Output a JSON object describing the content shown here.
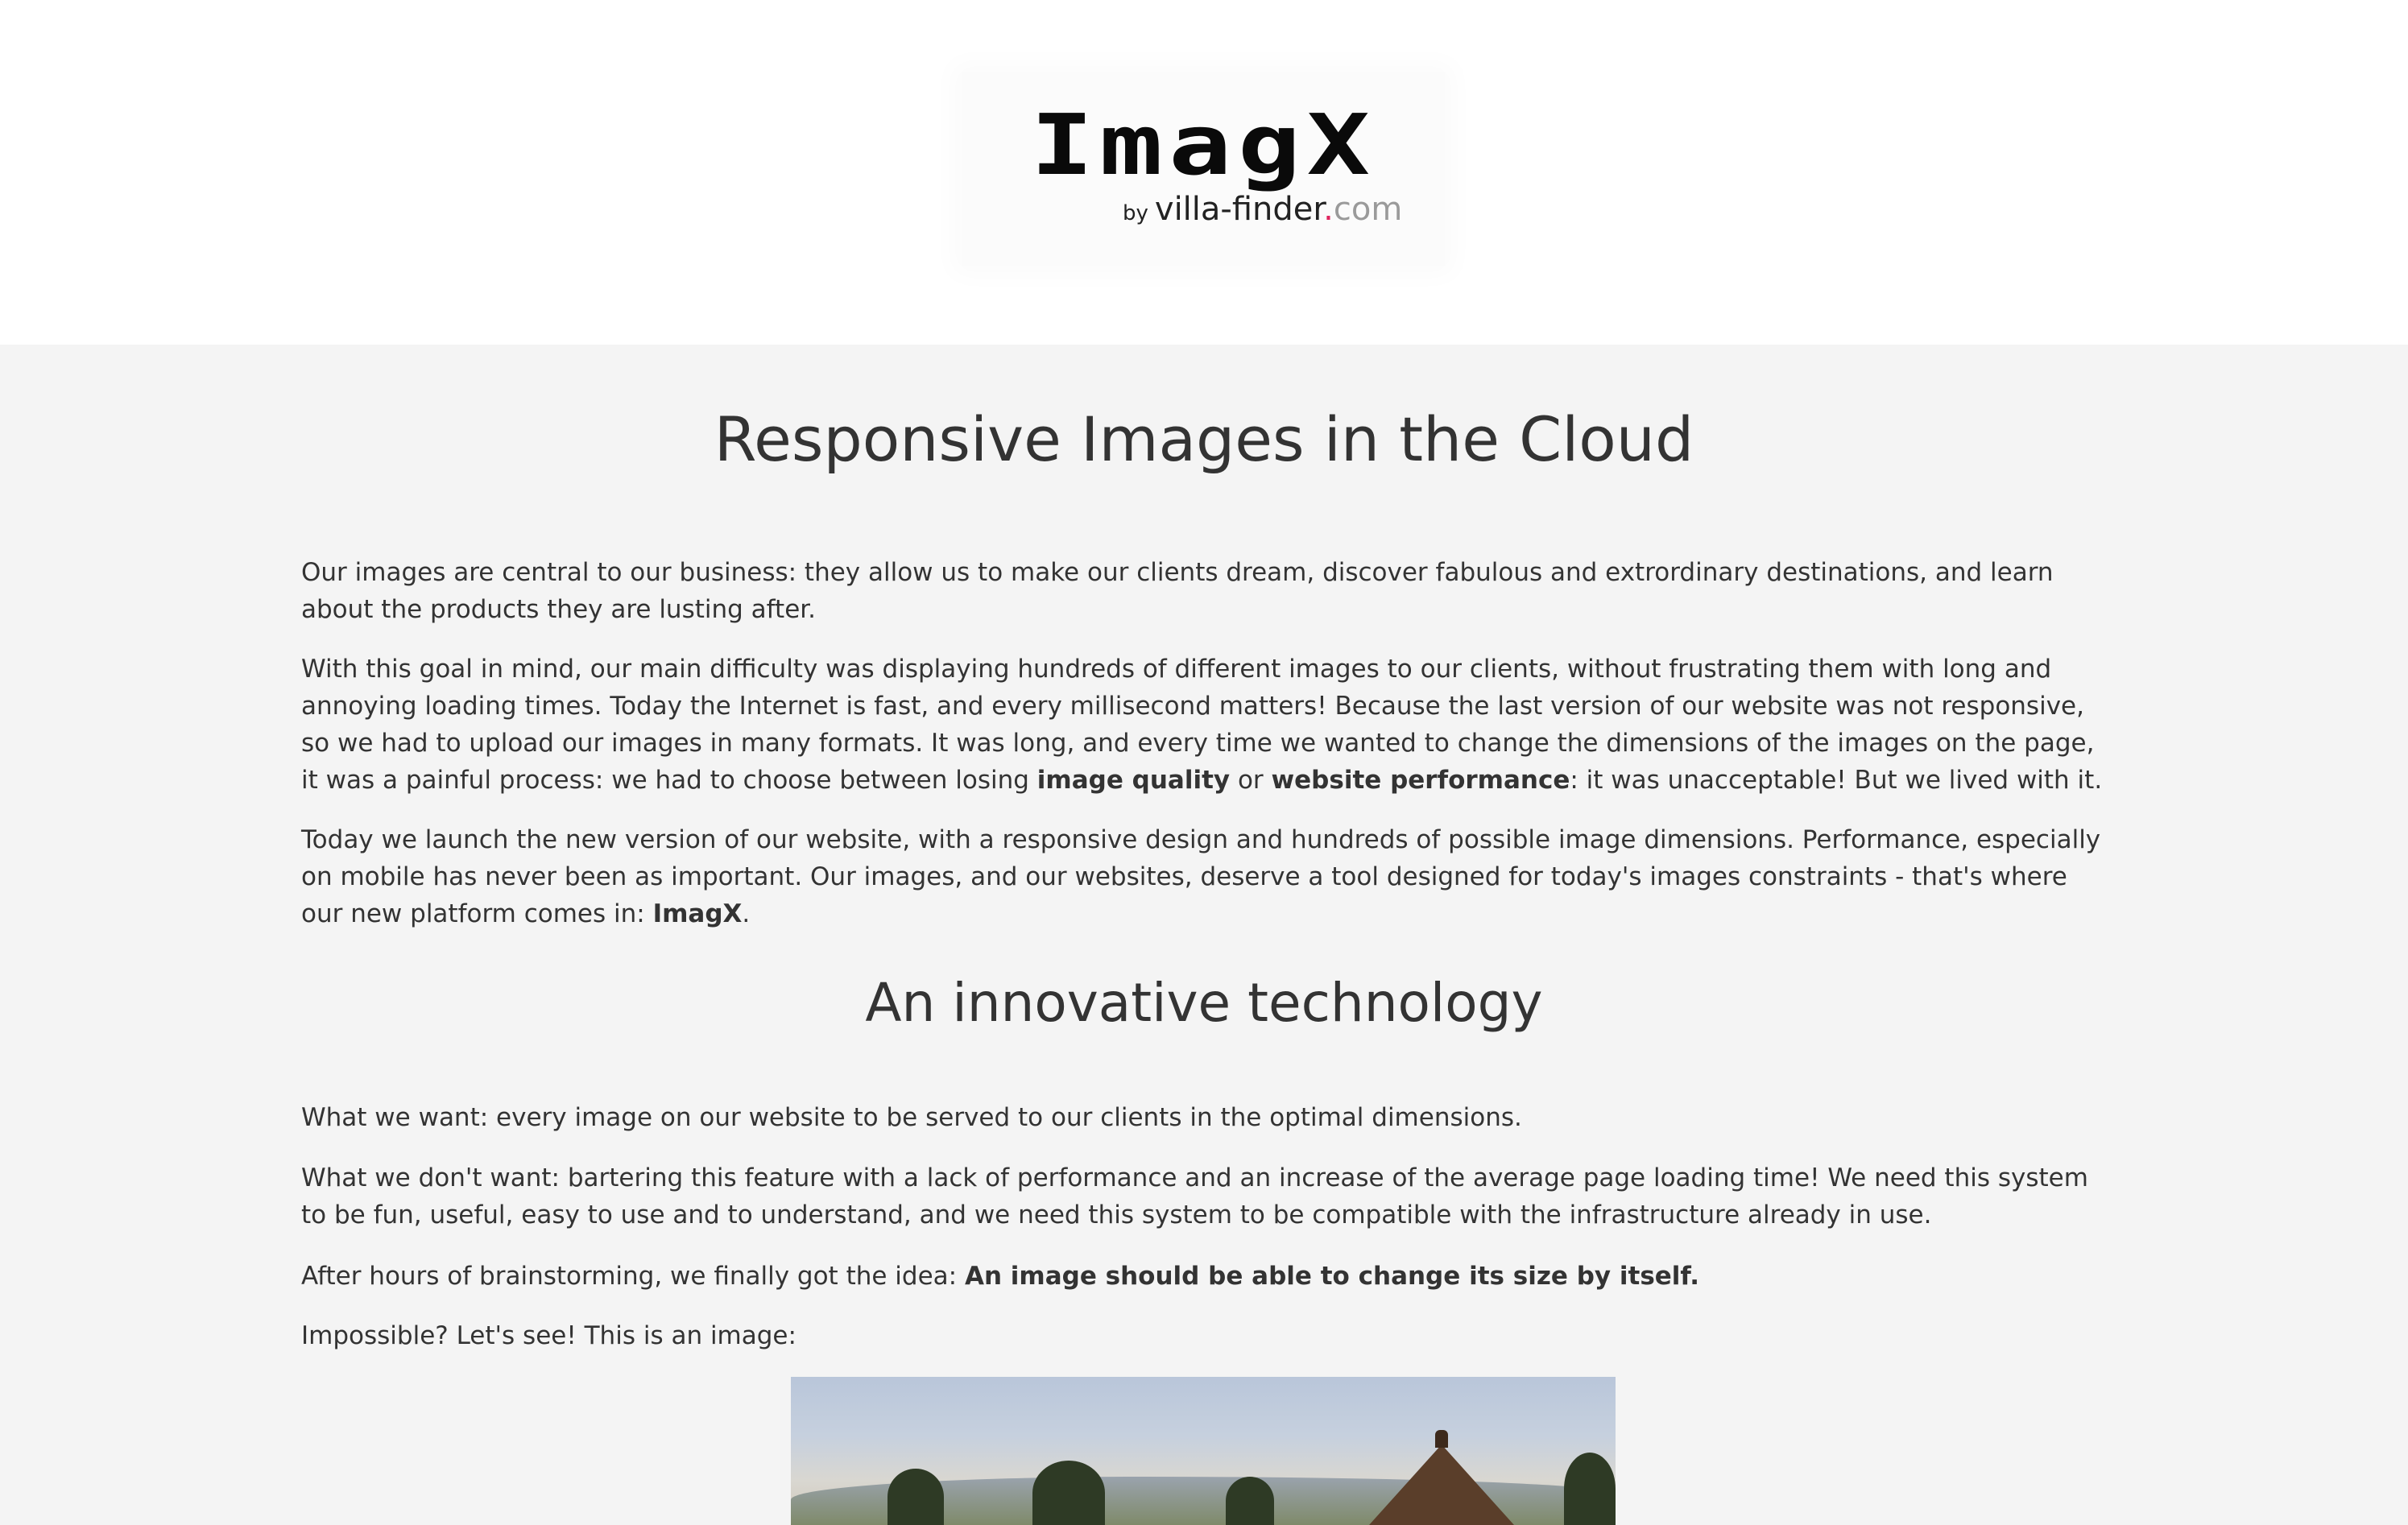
{
  "header": {
    "logo": {
      "mark": "ImagX",
      "by": "by",
      "brand": "villa-finder",
      "dot": ".",
      "tld": "com"
    }
  },
  "main": {
    "title": "Responsive Images in the Cloud",
    "intro": {
      "p1": "Our images are central to our business: they allow us to make our clients dream, discover fabulous and extrordinary destinations, and learn about the products they are lusting after.",
      "p2_a": "With this goal in mind, our main difficulty was displaying hundreds of different images to our clients, without frustrating them with long and annoying loading times. Today the Internet is fast, and every millisecond matters! Because the last version of our website was not responsive, so we had to upload our images in many formats. It was long, and every time we wanted to change the dimensions of the images on the page, it was a painful process: we had to choose between losing ",
      "p2_b": "image quality",
      "p2_c": " or ",
      "p2_d": "website performance",
      "p2_e": ": it was unacceptable! But we lived with it.",
      "p3_a": "Today we launch the new version of our website, with a responsive design and hundreds of possible image dimensions. Performance, especially on mobile has never been as important. Our images, and our websites, deserve a tool designed for today's images constraints - that's where our new platform comes in: ",
      "p3_b": "ImagX",
      "p3_c": "."
    },
    "section2": {
      "title": "An innovative technology",
      "p1": "What we want: every image on our website to be served to our clients in the optimal dimensions.",
      "p2": "What we don't want: bartering this feature with a lack of performance and an increase of the average page loading time! We need this system to be fun, useful, easy to use and to understand, and we need this system to be compatible with the infrastructure already in use.",
      "p3_a": "After hours of brainstorming, we finally got the idea: ",
      "p3_b": "An image should be able to change its size by itself.",
      "p4": "Impossible? Let's see! This is an image:"
    }
  }
}
